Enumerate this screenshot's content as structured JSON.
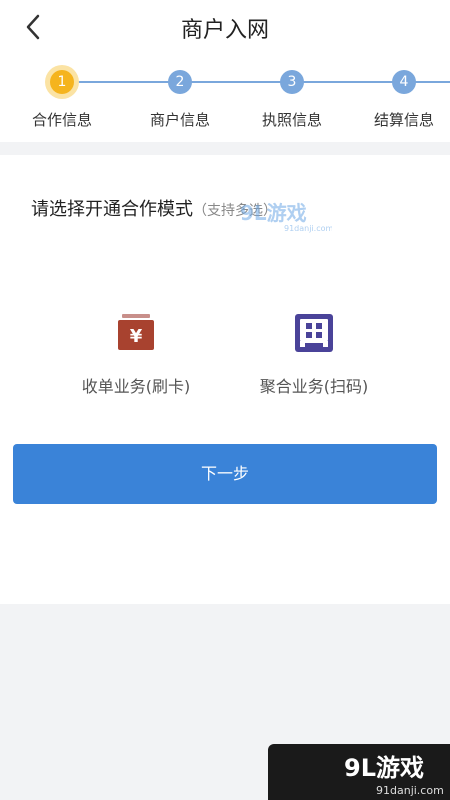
{
  "header": {
    "title": "商户入网",
    "back_icon": "chevron-left-icon"
  },
  "steps": [
    {
      "number": "1",
      "label": "合作信息",
      "active": true
    },
    {
      "number": "2",
      "label": "商户信息",
      "active": false
    },
    {
      "number": "3",
      "label": "执照信息",
      "active": false
    },
    {
      "number": "4",
      "label": "结算信息",
      "active": false
    }
  ],
  "content": {
    "prompt": "请选择开通合作模式",
    "prompt_sub": "（支持多选）",
    "options": [
      {
        "label": "收单业务(刷卡)",
        "icon": "card-payment-icon"
      },
      {
        "label": "聚合业务(扫码)",
        "icon": "qr-scan-icon"
      }
    ],
    "next_label": "下一步"
  },
  "watermark": {
    "brand": "9L游戏",
    "url": "91danji.com"
  },
  "colors": {
    "accent": "#3a83d8",
    "active_step": "#f5b41e",
    "step": "#7aa7dc"
  }
}
